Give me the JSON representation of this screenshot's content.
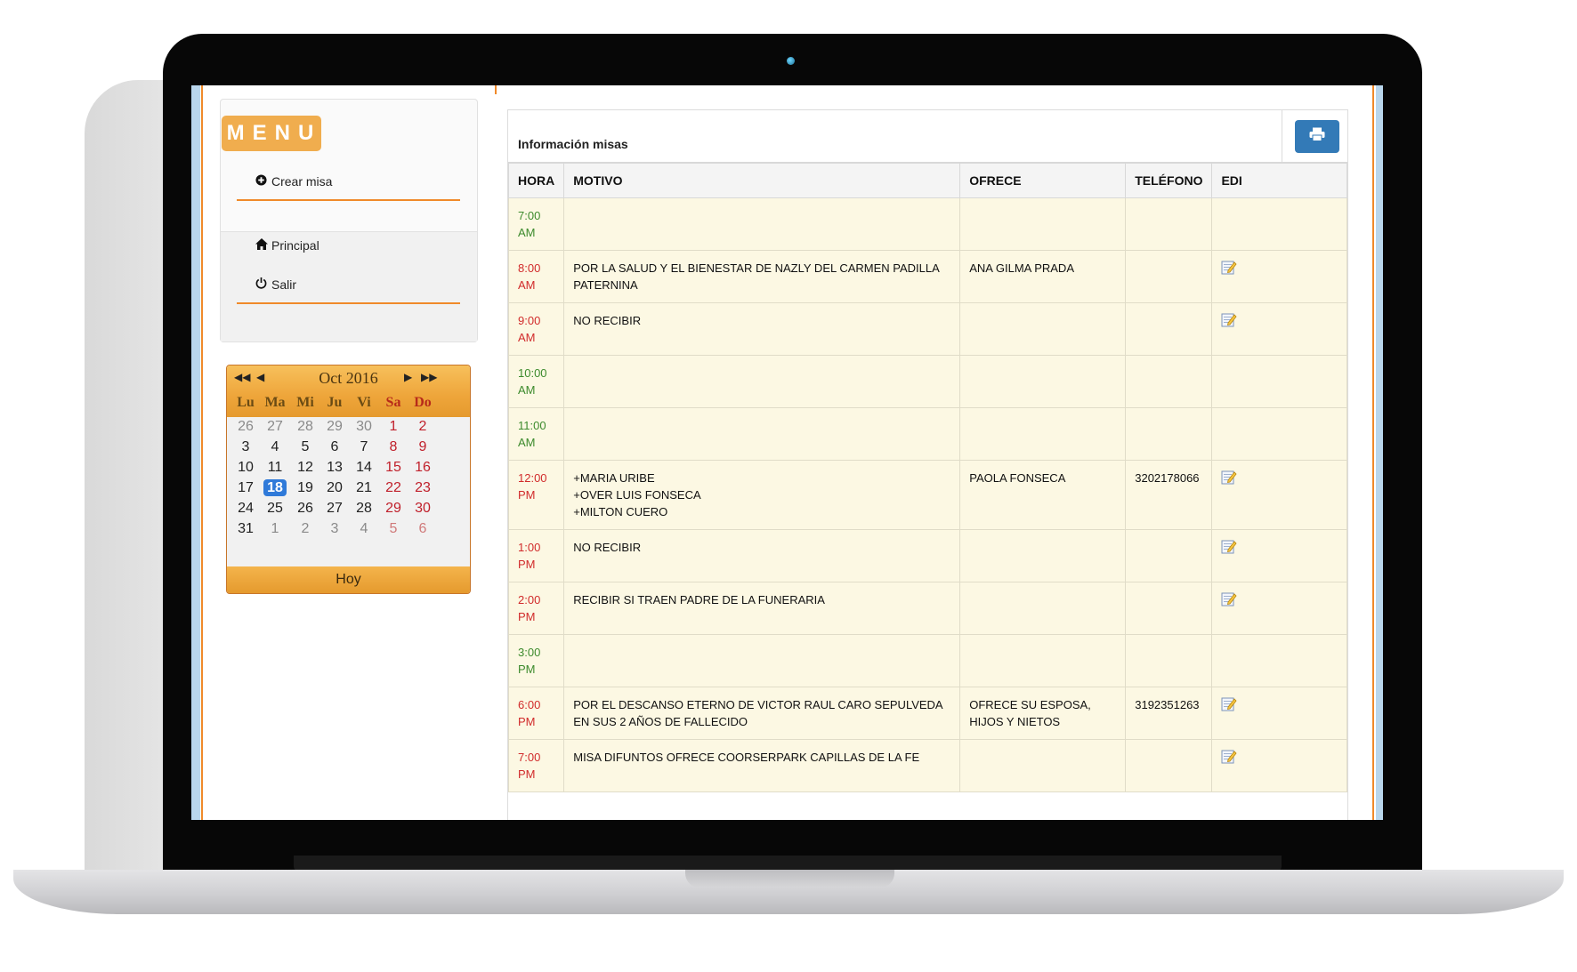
{
  "menu": {
    "title": "MENU",
    "items": [
      {
        "label": "Crear misa",
        "icon": "plus-circle-icon"
      },
      {
        "label": "Principal",
        "icon": "home-icon"
      },
      {
        "label": "Salir",
        "icon": "power-icon"
      }
    ]
  },
  "calendar": {
    "title": "Oct 2016",
    "weekdays": [
      "Lu",
      "Ma",
      "Mi",
      "Ju",
      "Vi",
      "Sa",
      "Do"
    ],
    "weeks": [
      [
        "26",
        "27",
        "28",
        "29",
        "30",
        "1",
        "2"
      ],
      [
        "3",
        "4",
        "5",
        "6",
        "7",
        "8",
        "9"
      ],
      [
        "10",
        "11",
        "12",
        "13",
        "14",
        "15",
        "16"
      ],
      [
        "17",
        "18",
        "19",
        "20",
        "21",
        "22",
        "23"
      ],
      [
        "24",
        "25",
        "26",
        "27",
        "28",
        "29",
        "30"
      ],
      [
        "31",
        "1",
        "2",
        "3",
        "4",
        "5",
        "6"
      ]
    ],
    "selected": "18",
    "today_label": "Hoy"
  },
  "panel": {
    "title": "Información misas",
    "print_icon": "print-icon"
  },
  "table": {
    "headers": [
      "HORA",
      "MOTIVO",
      "OFRECE",
      "TELÉFONO",
      "EDI"
    ],
    "rows": [
      {
        "hora": [
          "7:00",
          "AM"
        ],
        "status": "free",
        "motivo": [],
        "ofrece": "",
        "telefono": "",
        "edit": false
      },
      {
        "hora": [
          "8:00",
          "AM"
        ],
        "status": "busy",
        "motivo": [
          "POR LA SALUD Y EL BIENESTAR DE NAZLY DEL CARMEN PADILLA PATERNINA"
        ],
        "ofrece": "ANA GILMA PRADA",
        "telefono": "",
        "edit": true
      },
      {
        "hora": [
          "9:00",
          "AM"
        ],
        "status": "busy",
        "motivo": [
          "NO RECIBIR"
        ],
        "ofrece": "",
        "telefono": "",
        "edit": true
      },
      {
        "hora": [
          "10:00",
          "AM"
        ],
        "status": "free",
        "motivo": [],
        "ofrece": "",
        "telefono": "",
        "edit": false
      },
      {
        "hora": [
          "11:00",
          "AM"
        ],
        "status": "free",
        "motivo": [],
        "ofrece": "",
        "telefono": "",
        "edit": false
      },
      {
        "hora": [
          "12:00",
          "PM"
        ],
        "status": "busy",
        "motivo": [
          "+MARIA URIBE",
          "+OVER LUIS FONSECA",
          "+MILTON CUERO"
        ],
        "ofrece": "PAOLA FONSECA",
        "telefono": "3202178066",
        "edit": true
      },
      {
        "hora": [
          "1:00",
          "PM"
        ],
        "status": "busy",
        "motivo": [
          "NO RECIBIR"
        ],
        "ofrece": "",
        "telefono": "",
        "edit": true
      },
      {
        "hora": [
          "2:00",
          "PM"
        ],
        "status": "busy",
        "motivo": [
          "RECIBIR SI TRAEN PADRE DE LA FUNERARIA"
        ],
        "ofrece": "",
        "telefono": "",
        "edit": true
      },
      {
        "hora": [
          "3:00",
          "PM"
        ],
        "status": "free",
        "motivo": [],
        "ofrece": "",
        "telefono": "",
        "edit": false
      },
      {
        "hora": [
          "6:00",
          "PM"
        ],
        "status": "busy",
        "motivo": [
          "POR EL DESCANSO ETERNO DE VICTOR RAUL CARO SEPULVEDA EN SUS 2 AÑOS DE FALLECIDO"
        ],
        "ofrece": "OFRECE SU ESPOSA, HIJOS Y NIETOS",
        "telefono": "3192351263",
        "edit": true
      },
      {
        "hora": [
          "7:00",
          "PM"
        ],
        "status": "busy",
        "motivo": [
          "MISA DIFUNTOS OFRECE COORSERPARK CAPILLAS DE LA FE"
        ],
        "ofrece": "",
        "telefono": "",
        "edit": true
      }
    ]
  },
  "colors": {
    "accent_orange": "#f08a2a",
    "menu_badge": "#f0ad4e",
    "free_slot": "#3c8a2c",
    "busy_slot": "#d12b2b",
    "row_bg": "#fcf8e3",
    "print_button": "#337ab7"
  }
}
